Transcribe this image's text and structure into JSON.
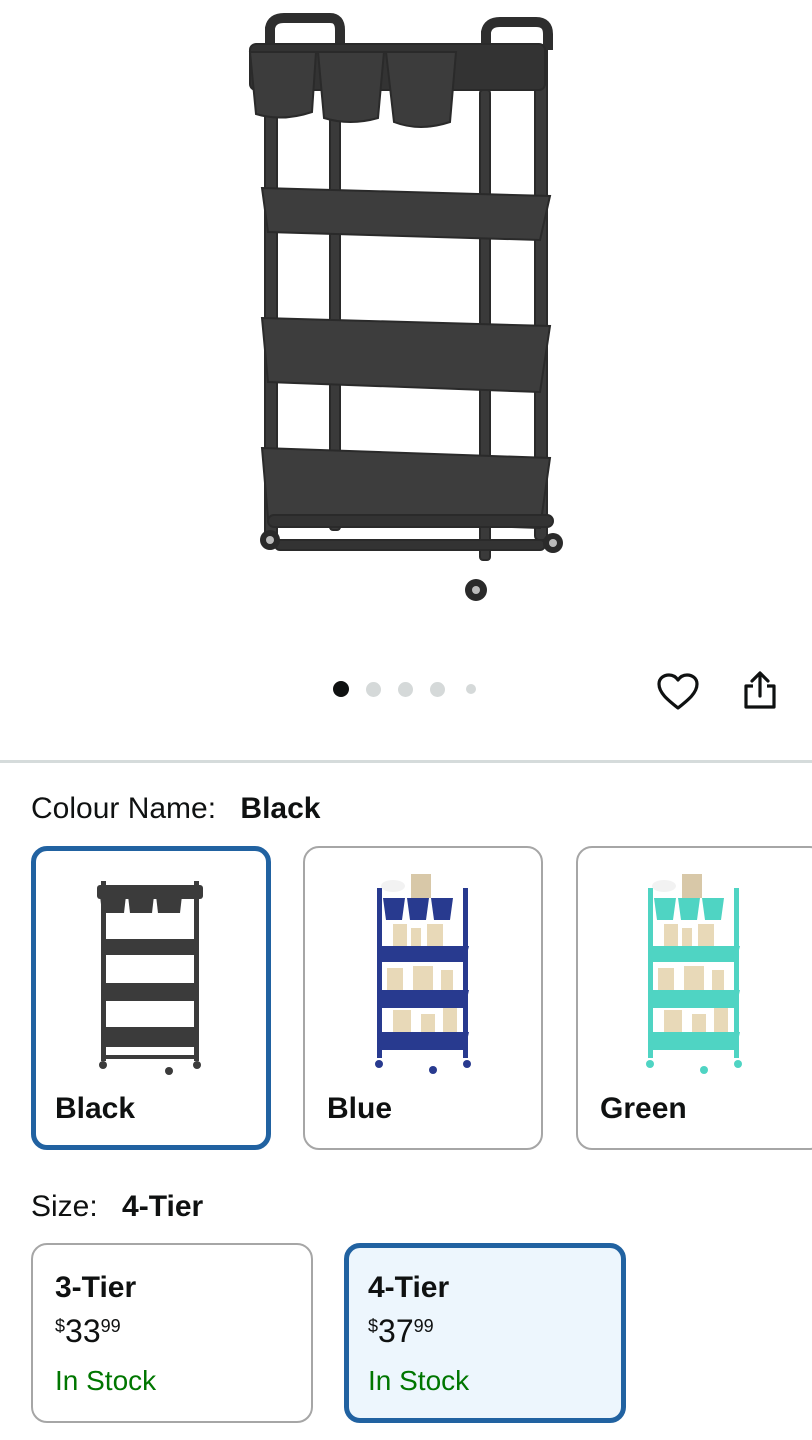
{
  "product": {
    "image_alt": "4-Tier rolling storage cart with hanging cups",
    "carousel": {
      "count": 5,
      "active": 0
    }
  },
  "actions": {
    "favorite_icon": "heart-icon",
    "share_icon": "share-icon"
  },
  "colour": {
    "label": "Colour Name:",
    "selected": "Black",
    "options": [
      {
        "name": "Black",
        "color": "#3b3b3b",
        "selected": true
      },
      {
        "name": "Blue",
        "color": "#283a8f",
        "selected": false
      },
      {
        "name": "Green",
        "color": "#4fd4c3",
        "selected": false
      }
    ]
  },
  "size": {
    "label": "Size:",
    "selected": "4-Tier",
    "options": [
      {
        "name": "3-Tier",
        "currency": "$",
        "dollars": "33",
        "cents": "99",
        "stock": "In Stock",
        "selected": false
      },
      {
        "name": "4-Tier",
        "currency": "$",
        "dollars": "37",
        "cents": "99",
        "stock": "In Stock",
        "selected": true
      }
    ]
  },
  "colors": {
    "accent": "#2162a1",
    "in_stock": "#007600",
    "selected_bg": "#edf6fd"
  }
}
